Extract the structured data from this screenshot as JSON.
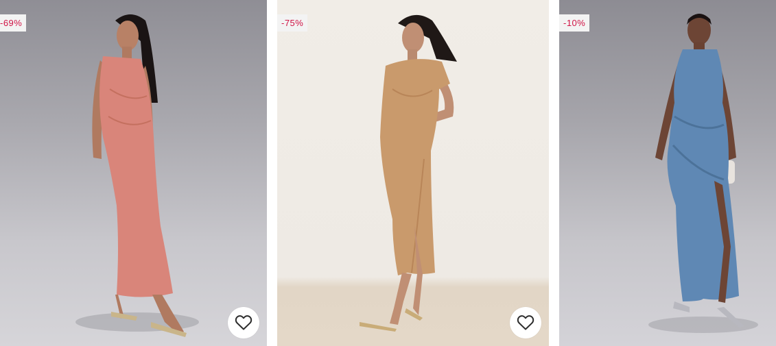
{
  "products": [
    {
      "discount": "-69%",
      "dress_color": "#d9857a",
      "has_wishlist": true,
      "wishlist_icon": "heart-outline-icon"
    },
    {
      "discount": "-75%",
      "dress_color": "#c99a6c",
      "has_wishlist": true,
      "wishlist_icon": "heart-outline-icon"
    },
    {
      "discount": "-10%",
      "dress_color": "#5f88b4",
      "has_wishlist": false
    }
  ],
  "colors": {
    "badge_text": "#d01345",
    "badge_bg": "#f3f3f3"
  }
}
